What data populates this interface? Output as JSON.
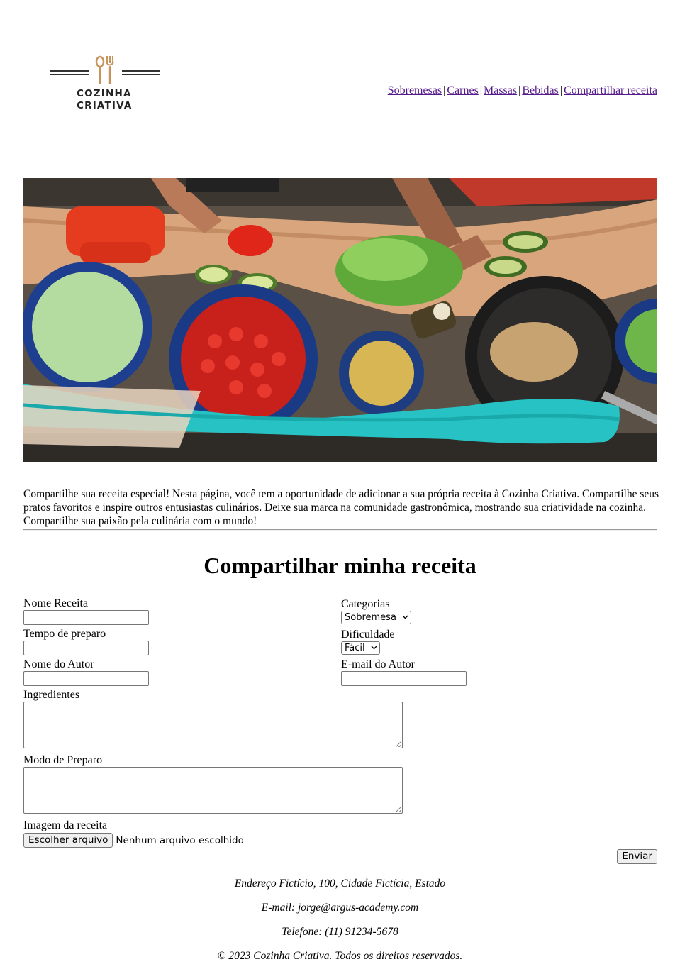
{
  "header": {
    "logo_line1": "COZINHA",
    "logo_line2": "CRIATIVA",
    "nav": [
      "Sobremesas",
      "Carnes",
      "Massas",
      "Bebidas",
      "Compartilhar receita"
    ]
  },
  "colors": {
    "link": "#551a8b",
    "logo_accent": "#c9935c"
  },
  "hero_alt": "",
  "intro": "Compartilhe sua receita especial! Nesta página, você tem a oportunidade de adicionar a sua própria receita à Cozinha Criativa. Compartilhe seus pratos favoritos e inspire outros entusiastas culinários. Deixe sua marca na comunidade gastronômica, mostrando sua criatividade na cozinha. Compartilhe sua paixão pela culinária com o mundo!",
  "form": {
    "title": "Compartilhar minha receita",
    "recipe_name_label": "Nome Receita",
    "recipe_name_value": "",
    "categories_label": "Categorias",
    "categories_selected": "Sobremesa",
    "prep_time_label": "Tempo de preparo",
    "prep_time_value": "",
    "difficulty_label": "Dificuldade",
    "difficulty_selected": "Fácil",
    "author_name_label": "Nome do Autor",
    "author_name_value": "",
    "author_email_label": "E-mail do Autor",
    "author_email_value": "",
    "ingredients_label": "Ingredientes",
    "method_label": "Modo de Preparo",
    "image_label": "Imagem da receita",
    "file_button": "Escolher arquivo",
    "file_status": "Nenhum arquivo escolhido",
    "submit": "Enviar"
  },
  "footer": {
    "address": "Endereço Fictício, 100, Cidade Fictícia, Estado",
    "email": "E-mail: jorge@argus-academy.com",
    "phone": "Telefone: (11) 91234-5678",
    "copyright": "© 2023 Cozinha Criativa. Todos os direitos reservados."
  }
}
